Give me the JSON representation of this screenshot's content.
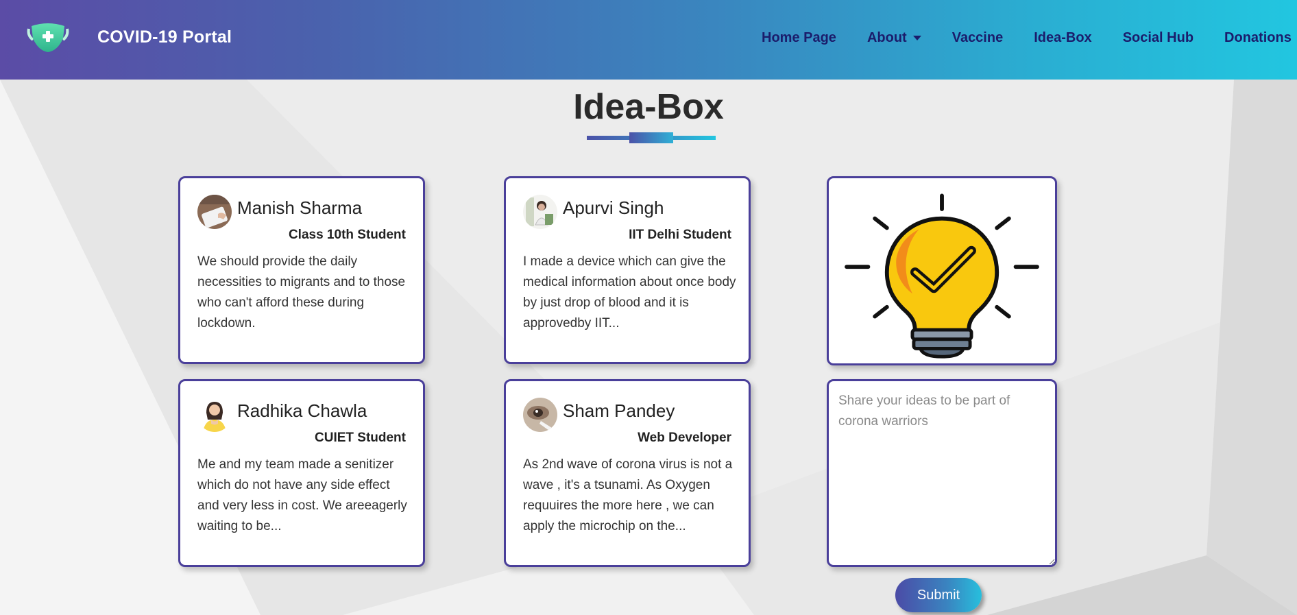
{
  "header": {
    "brand_name": "COVID-19 Portal",
    "logo_icon": "face-mask-icon",
    "nav": [
      {
        "label": "Home Page"
      },
      {
        "label": "About",
        "has_dropdown": true
      },
      {
        "label": "Vaccine"
      },
      {
        "label": "Idea-Box"
      },
      {
        "label": "Social Hub"
      },
      {
        "label": "Donations"
      }
    ]
  },
  "page": {
    "title": "Idea-Box"
  },
  "ideas": [
    {
      "name": "Manish Sharma",
      "role": "Class 10th Student",
      "text": "We should provide the daily necessities to migrants and to those who can't afford these during lockdown."
    },
    {
      "name": "Apurvi Singh",
      "role": "IIT Delhi Student",
      "text": "I made a device which can give the medical information about once body by just drop of blood and it is approvedby IIT..."
    },
    {
      "name": "Radhika Chawla",
      "role": "CUIET Student",
      "text": "Me and my team made a senitizer which do not have any side effect and very less in cost. We areeagerly waiting to be..."
    },
    {
      "name": "Sham Pandey",
      "role": "Web Developer",
      "text": "As 2nd wave of corona virus is not a wave , it's a tsunami. As Oxygen requuires the more here , we can apply the microchip on the..."
    }
  ],
  "share": {
    "image_icon": "lightbulb-check-icon",
    "placeholder": "Share your ideas to be part of corona warriors",
    "value": "",
    "submit_label": "Submit"
  },
  "colors": {
    "header_gradient_start": "#5b4ca6",
    "header_gradient_end": "#22c6e0",
    "nav_text": "#1b1c6b",
    "card_border": "#4a3f9a",
    "bulb_yellow": "#f9c80e"
  }
}
